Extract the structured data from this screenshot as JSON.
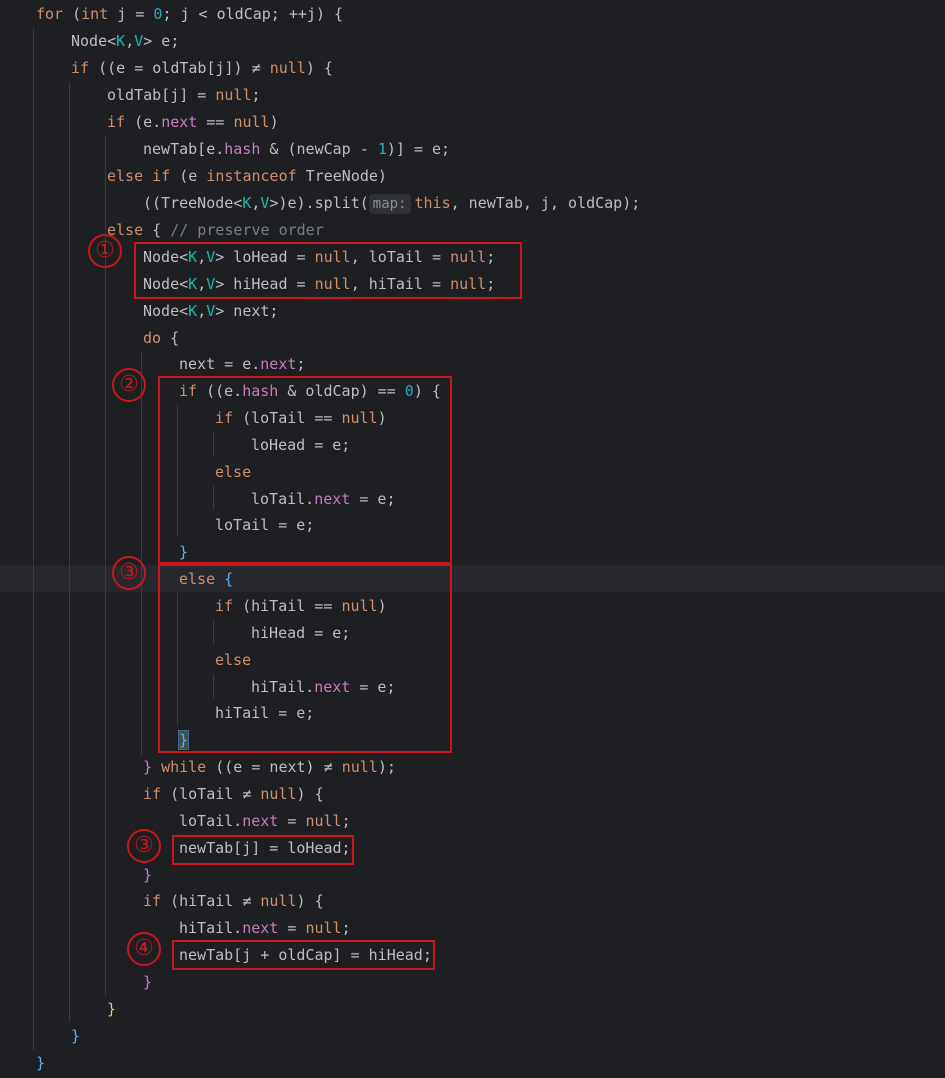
{
  "code": {
    "l01": [
      "for",
      " (",
      "int",
      " j = ",
      "0",
      "; j < oldCap; ++j) {"
    ],
    "l02": [
      "Node<",
      "K",
      ",",
      "V",
      "> e;"
    ],
    "l03": [
      "if",
      " ((e = oldTab[j]) ≠ ",
      "null",
      ") {"
    ],
    "l04": [
      "oldTab[j] = ",
      "null",
      ";"
    ],
    "l05": [
      "if",
      " (e.",
      "next",
      " == ",
      "null",
      ")"
    ],
    "l06": [
      "newTab[e.",
      "hash",
      " & (newCap - ",
      "1",
      ")] = e;"
    ],
    "l07": [
      "else if",
      " (e ",
      "instanceof",
      " TreeNode)"
    ],
    "l08": [
      "((TreeNode<",
      "K",
      ",",
      "V",
      ">)e).split(",
      "map:",
      "this",
      ", newTab, j, oldCap);"
    ],
    "l09": [
      "else",
      " { ",
      "// preserve order"
    ],
    "l10": [
      "Node<",
      "K",
      ",",
      "V",
      "> loHead = ",
      "null",
      ", loTail = ",
      "null",
      ";"
    ],
    "l11": [
      "Node<",
      "K",
      ",",
      "V",
      "> hiHead = ",
      "null",
      ", hiTail = ",
      "null",
      ";"
    ],
    "l12": [
      "Node<",
      "K",
      ",",
      "V",
      "> next;"
    ],
    "l13": [
      "do",
      " {"
    ],
    "l14": [
      "next = e.",
      "next",
      ";"
    ],
    "l15": [
      "if",
      " ((e.",
      "hash",
      " & oldCap) == ",
      "0",
      ") {"
    ],
    "l16": [
      "if",
      " (loTail == ",
      "null",
      ")"
    ],
    "l17": [
      "loHead = e;"
    ],
    "l18": [
      "else"
    ],
    "l19": [
      "loTail.",
      "next",
      " = e;"
    ],
    "l20": [
      "loTail = e;"
    ],
    "l21": [
      "}"
    ],
    "l22": [
      "else",
      " {"
    ],
    "l23": [
      "if",
      " (hiTail == ",
      "null",
      ")"
    ],
    "l24": [
      "hiHead = e;"
    ],
    "l25": [
      "else"
    ],
    "l26": [
      "hiTail.",
      "next",
      " = e;"
    ],
    "l27": [
      "hiTail = e;"
    ],
    "l28": [
      "}"
    ],
    "l29": [
      "} ",
      "while",
      " ((e = next) ≠ ",
      "null",
      ");"
    ],
    "l30": [
      "if",
      " (loTail ≠ ",
      "null",
      ") {"
    ],
    "l31": [
      "loTail.",
      "next",
      " = ",
      "null",
      ";"
    ],
    "l32": [
      "newTab[j] = loHead;"
    ],
    "l33": [
      "}"
    ],
    "l34": [
      "if",
      " (hiTail ≠ ",
      "null",
      ") {"
    ],
    "l35": [
      "hiTail.",
      "next",
      " = ",
      "null",
      ";"
    ],
    "l36": [
      "newTab[j + oldCap] = hiHead;"
    ],
    "l37": [
      "}"
    ],
    "l38": [
      "}"
    ],
    "l39": [
      "}"
    ],
    "l40": [
      "}"
    ]
  },
  "annotations": [
    "①",
    "②",
    "③",
    "③",
    "④"
  ],
  "colors": {
    "background": "#1e1f22",
    "keyword": "#cf8e6d",
    "field": "#c77dbb",
    "number": "#2aacb8",
    "comment": "#7a7e85",
    "generic": "#16baac",
    "annotation": "#c8161d"
  }
}
